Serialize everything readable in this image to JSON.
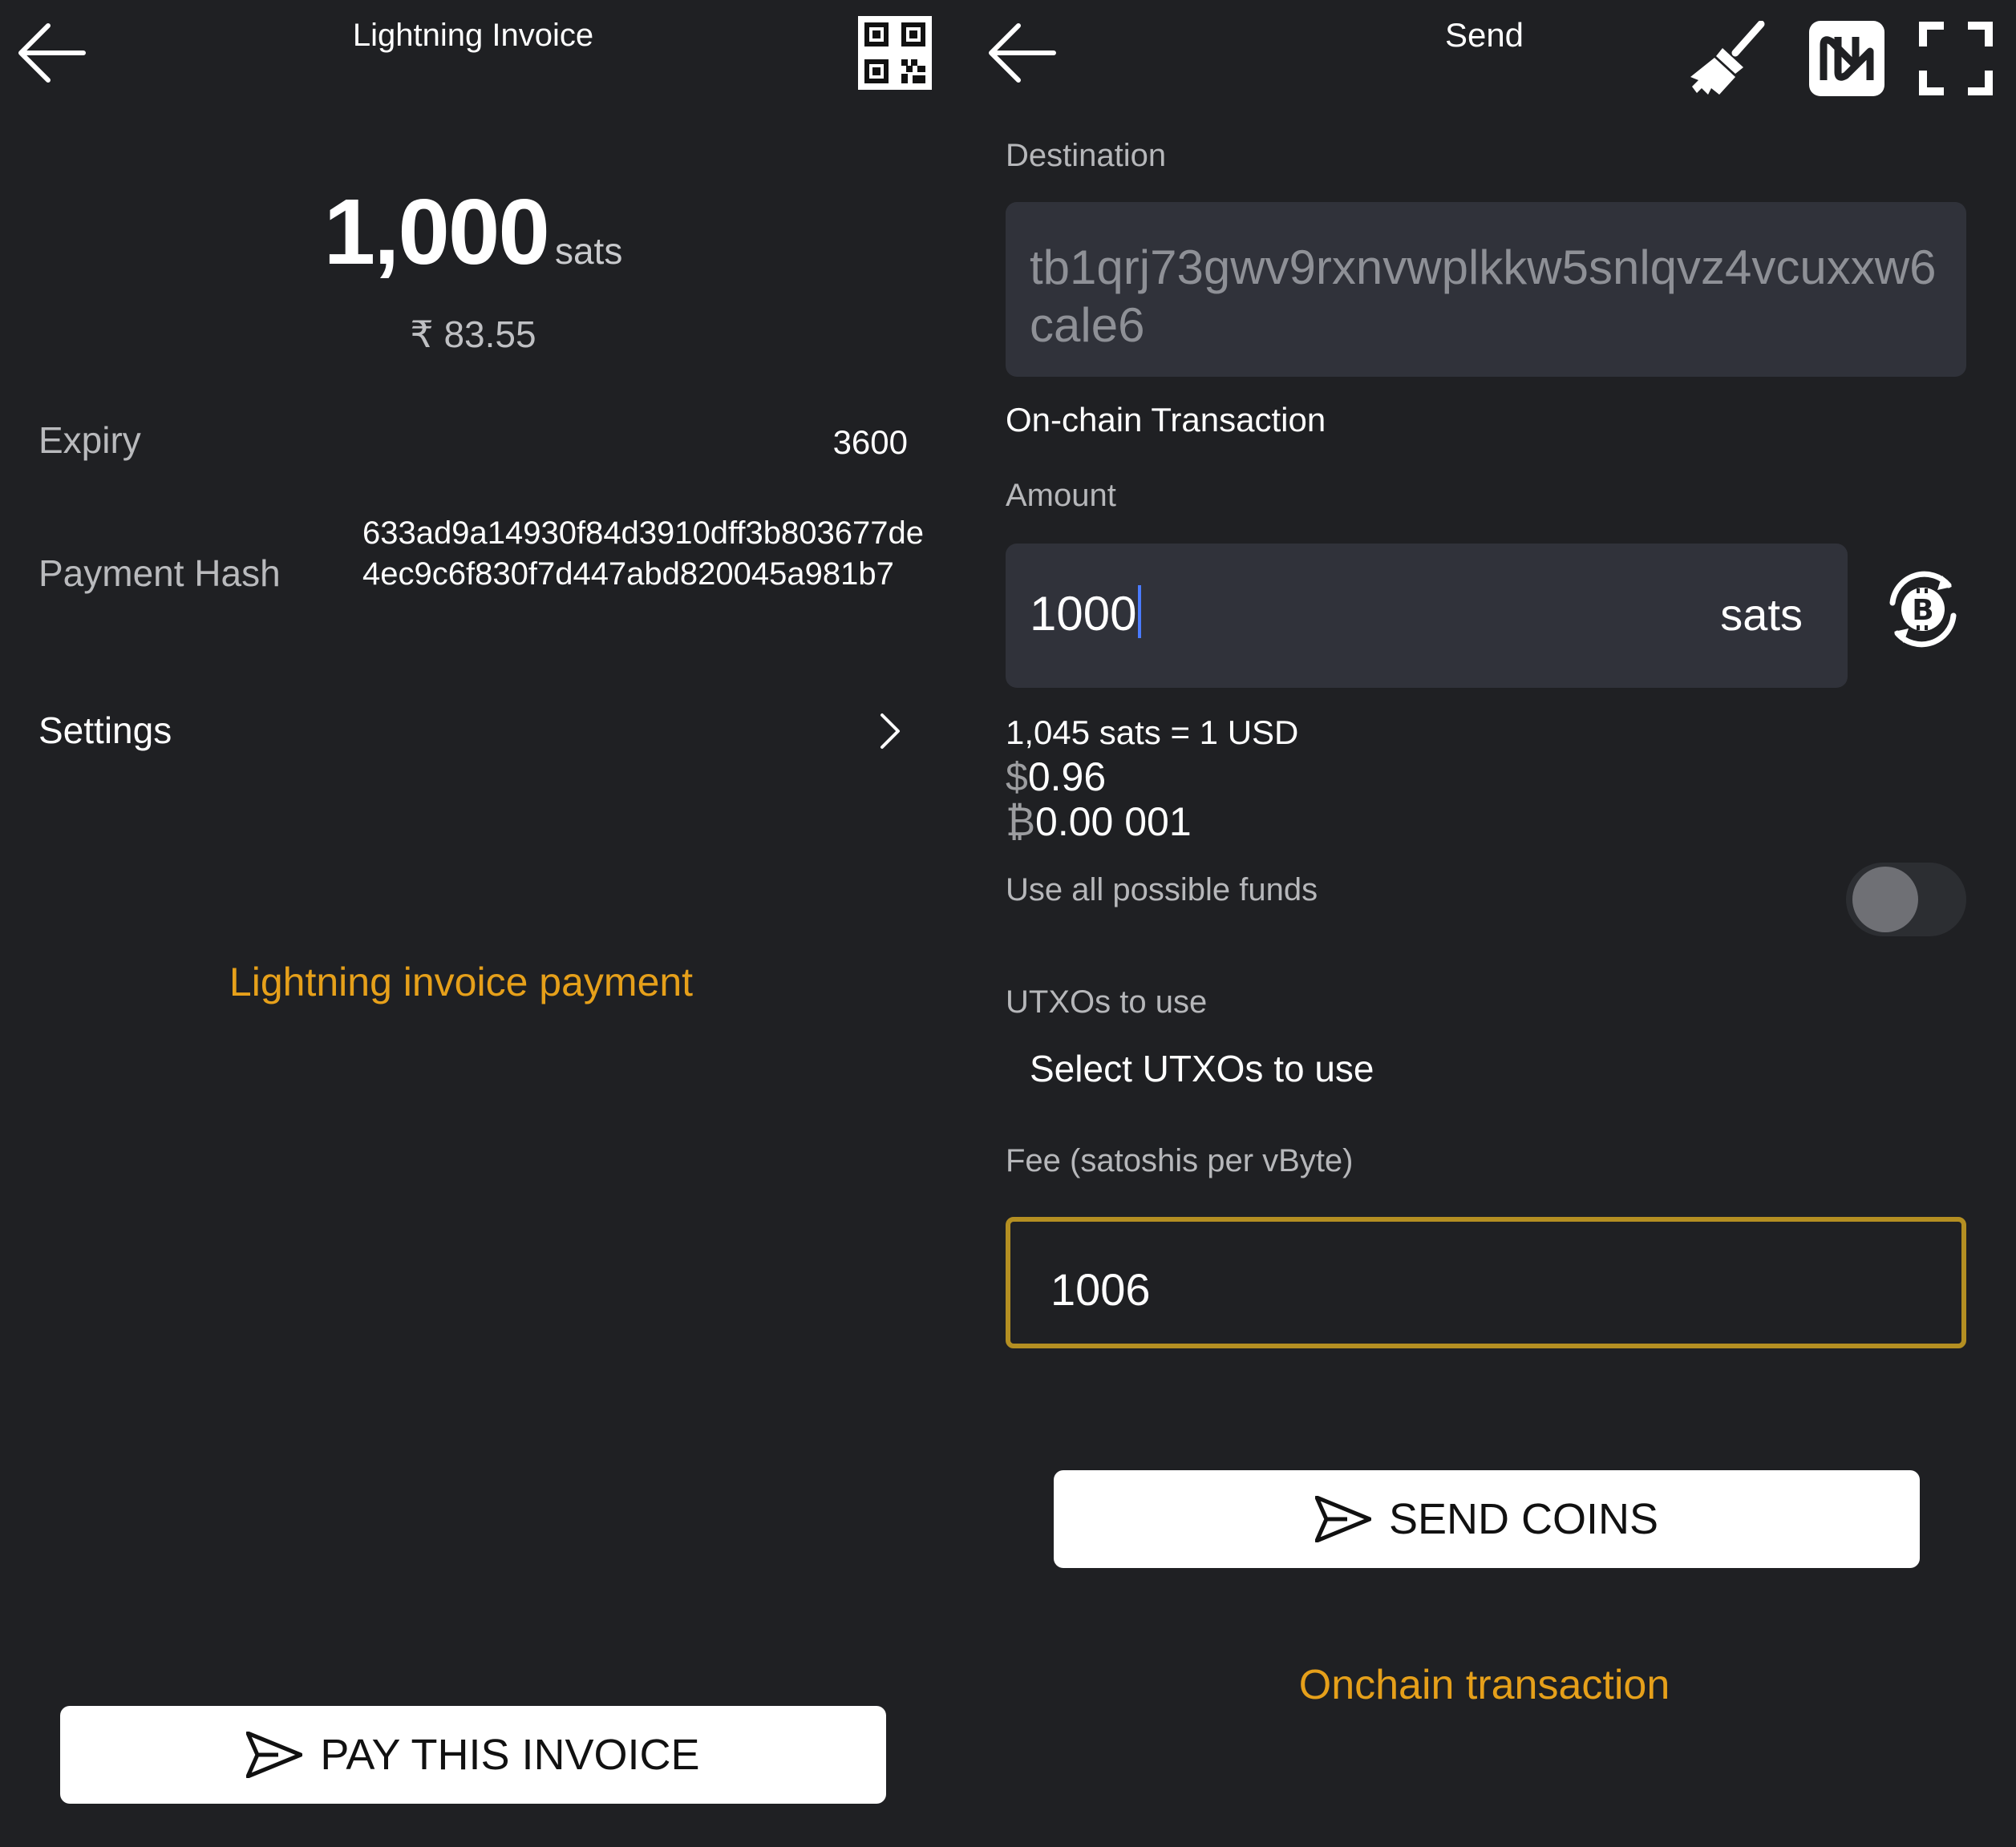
{
  "left": {
    "title": "Lightning Invoice",
    "amount": "1,000",
    "amount_unit": "sats",
    "fiat": "₹ 83.55",
    "expiry_label": "Expiry",
    "expiry_value": "3600",
    "payment_hash_label": "Payment Hash",
    "payment_hash_value": "633ad9a14930f84d3910dff3b803677de4ec9c6f830f7d447abd820045a981b7",
    "settings_label": "Settings",
    "caption": "Lightning invoice payment",
    "pay_button": "PAY THIS INVOICE",
    "icons": [
      "arrow-left-icon",
      "qr-code-icon",
      "chevron-right-icon",
      "send-icon"
    ]
  },
  "right": {
    "title": "Send",
    "destination_label": "Destination",
    "destination_value": "tb1qrj73gwv9rxnvwplkkw5snlqvz4vcuxxw6cale6",
    "tx_type": "On-chain Transaction",
    "amount_label": "Amount",
    "amount_value": "1000",
    "amount_unit": "sats",
    "rate": "1,045 sats = 1 USD",
    "usd_symbol": "$",
    "usd_value": "0.96",
    "btc_symbol": "₿",
    "btc_value": "0.00 001",
    "use_all_label": "Use all possible funds",
    "use_all_enabled": false,
    "utxo_label": "UTXOs to use",
    "utxo_select": "Select UTXOs to use",
    "fee_label": "Fee (satoshis per vByte)",
    "fee_value": "1006",
    "send_button": "SEND COINS",
    "caption": "Onchain transaction",
    "icons": [
      "arrow-left-icon",
      "broom-icon",
      "nfc-icon",
      "fullscreen-icon",
      "bitcoin-swap-icon",
      "send-icon"
    ]
  },
  "colors": {
    "background": "#1f2023",
    "accent": "#e6a01a",
    "fee_border": "#b48f22",
    "input_bg": "#30323a"
  }
}
